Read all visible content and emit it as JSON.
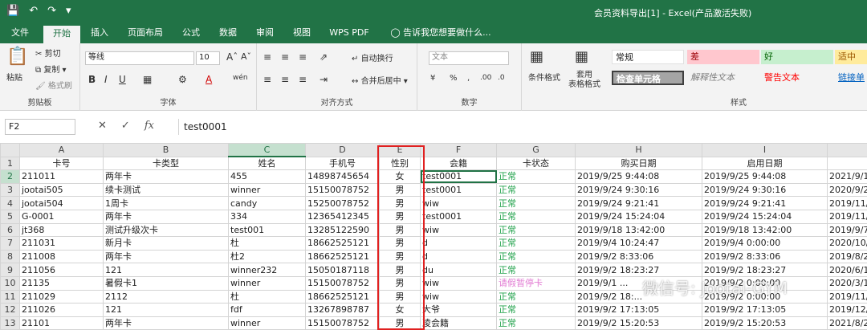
{
  "titlebar": {
    "title": "会员资料导出[1] - Excel(产品激活失败)"
  },
  "tabs": [
    "文件",
    "开始",
    "插入",
    "页面布局",
    "公式",
    "数据",
    "审阅",
    "视图",
    "WPS PDF",
    "告诉我您想要做什么..."
  ],
  "ribbon": {
    "clipboard": {
      "paste": "粘贴",
      "cut": "剪切",
      "copy": "复制",
      "format_painter": "格式刷",
      "label": "剪贴板"
    },
    "font": {
      "name": "等线",
      "size": "10",
      "label": "字体"
    },
    "alignment": {
      "wrap": "自动换行",
      "merge": "合并后居中",
      "label": "对齐方式"
    },
    "number": {
      "format": "文本",
      "label": "数字"
    },
    "styles": {
      "cond": "条件格式",
      "table": "套用\n表格格式",
      "normal": "常规",
      "bad": "差",
      "good": "好",
      "neutral": "适中",
      "check": "检查单元格",
      "explain": "解释性文本",
      "warn": "警告文本",
      "link": "链接单",
      "label": "样式"
    }
  },
  "formula": {
    "name_box": "F2",
    "fx": "fx",
    "value": "test0001"
  },
  "columns": [
    "A",
    "B",
    "C",
    "D",
    "E",
    "F",
    "G",
    "H",
    "I",
    ""
  ],
  "rows": [
    [
      "卡号",
      "卡类型",
      "姓名",
      "手机号",
      "性别",
      "会籍",
      "卡状态",
      "购买日期",
      "启用日期",
      ""
    ],
    [
      "211011",
      "两年卡",
      "455",
      "14898745654",
      "女",
      "test0001",
      "正常",
      "2019/9/25 9:44:08",
      "2019/9/25 9:44:08",
      "2021/9/1"
    ],
    [
      "jootai505",
      "续卡测试",
      "winner",
      "15150078752",
      "男",
      "test0001",
      "正常",
      "2019/9/24 9:30:16",
      "2019/9/24 9:30:16",
      "2020/9/2"
    ],
    [
      "jootai504",
      "1周卡",
      "candy",
      "15250078752",
      "男",
      "wiw",
      "正常",
      "2019/9/24 9:21:41",
      "2019/9/24 9:21:41",
      "2019/11/"
    ],
    [
      "G-0001",
      "两年卡",
      "334",
      "12365412345",
      "男",
      "test0001",
      "正常",
      "2019/9/24 15:24:04",
      "2019/9/24 15:24:04",
      "2019/11/"
    ],
    [
      "jt368",
      "测试升级次卡",
      "test001",
      "13285122590",
      "男",
      "wiw",
      "正常",
      "2019/9/18 13:42:00",
      "2019/9/18 13:42:00",
      "2019/9/7"
    ],
    [
      "211031",
      "新月卡",
      "杜",
      "18662525121",
      "男",
      "d",
      "正常",
      "2019/9/4 10:24:47",
      "2019/9/4 0:00:00",
      "2020/10/"
    ],
    [
      "211008",
      "两年卡",
      "杜2",
      "18662525121",
      "男",
      "d",
      "正常",
      "2019/9/2 8:33:06",
      "2019/9/2 8:33:06",
      "2019/8/2"
    ],
    [
      "211056",
      "121",
      "winner232",
      "15050187118",
      "男",
      "du",
      "正常",
      "2019/9/2 18:23:27",
      "2019/9/2 18:23:27",
      "2020/6/1"
    ],
    [
      "21135",
      "暑假卡1",
      "winner",
      "15150078752",
      "男",
      "wiw",
      "请假暂停卡",
      "2019/9/1 ...",
      "2019/9/2 0:00:00",
      "2020/3/1"
    ],
    [
      "211029",
      "2112",
      "杜",
      "18662525121",
      "男",
      "wiw",
      "正常",
      "2019/9/2 18:...",
      "2019/9/2 0:00:00",
      "2019/11/"
    ],
    [
      "211026",
      "121",
      "fdf",
      "13267898787",
      "女",
      "大爷",
      "正常",
      "2019/9/2 17:13:05",
      "2019/9/2 17:13:05",
      "2019/12/"
    ],
    [
      "21101",
      "两年卡",
      "winner",
      "15150078752",
      "男",
      "凌会籍",
      "正常",
      "2019/9/2 15:20:53",
      "2019/9/2 15:20:53",
      "2021/8/2"
    ]
  ],
  "watermark": "微信号: Jootai-GYM"
}
